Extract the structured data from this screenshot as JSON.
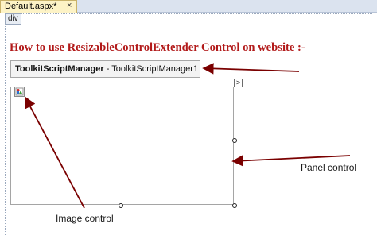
{
  "tab": {
    "title": "Default.aspx*",
    "close_glyph": "×"
  },
  "designer": {
    "div_tag": "div",
    "heading": "How to use ResizableControlExtender Control on website :-",
    "script_manager": {
      "type": "ToolkitScriptManager",
      "separator": " - ",
      "id": "ToolkitScriptManager1"
    },
    "smart_tag_glyph": ">",
    "image_icon": "broken-image-icon"
  },
  "annotations": {
    "panel_label": "Panel control",
    "image_label": "Image control"
  },
  "colors": {
    "heading": "#b21a1a",
    "arrow": "#7a0000",
    "tab_active": "#fdf3c6"
  }
}
